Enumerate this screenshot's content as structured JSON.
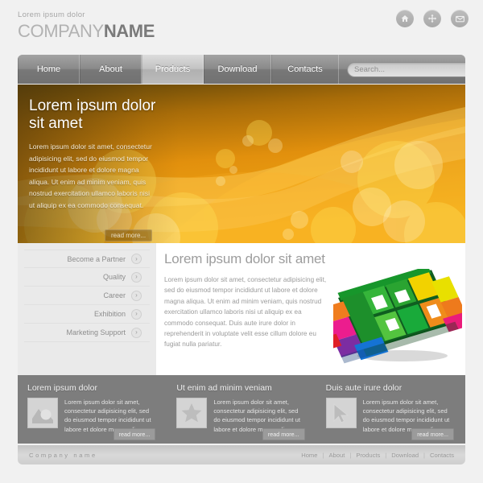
{
  "header": {
    "tagline": "Lorem ipsum dolor",
    "brand_light": "COMPANY",
    "brand_bold": "NAME",
    "icons": [
      {
        "name": "home-icon",
        "title": "Home"
      },
      {
        "name": "sitemap-move-icon",
        "title": "Sitemap"
      },
      {
        "name": "mail-icon",
        "title": "Contact"
      }
    ]
  },
  "nav": {
    "items": [
      {
        "label": "Home",
        "active": false
      },
      {
        "label": "About",
        "active": false
      },
      {
        "label": "Products",
        "active": true
      },
      {
        "label": "Download",
        "active": false
      },
      {
        "label": "Contacts",
        "active": false
      }
    ],
    "search": {
      "placeholder": "Search...",
      "value": "",
      "button_icon": "search-icon"
    }
  },
  "hero": {
    "title": "Lorem ipsum dolor sit amet",
    "body": "Lorem ipsum dolor sit amet, consectetur adipisicing elit, sed do eiusmod tempor incididunt ut labore et dolore magna aliqua. Ut enim ad minim veniam, quis nostrud exercitation ullamco laboris nisi ut aliquip ex ea commodo consequat.",
    "read_more": "read more...",
    "accent_color": "#e8940c",
    "background_colors": [
      "#6e4c0d",
      "#c87a0a",
      "#f2a81a",
      "#ffd84a"
    ]
  },
  "sidebar": {
    "items": [
      {
        "label": "Become a Partner",
        "icon": "chevron-right-icon"
      },
      {
        "label": "Quality",
        "icon": "chevron-right-icon"
      },
      {
        "label": "Career",
        "icon": "chevron-right-icon"
      },
      {
        "label": "Exhibition",
        "icon": "chevron-right-icon"
      },
      {
        "label": "Marketing Support",
        "icon": "chevron-right-icon"
      }
    ]
  },
  "content": {
    "title": "Lorem ipsum dolor sit amet",
    "body": "Lorem ipsum dolor sit amet, consectetur adipisicing elit, sed do eiusmod tempor incididunt ut labore et dolore magna aliqua. Ut enim ad minim veniam, quis nostrud exercitation ullamco laboris nisi ut aliquip ex ea commodo consequat. Duis aute irure dolor in reprehenderit in voluptate velit esse cillum dolore eu fugiat nulla pariatur.",
    "illustration": "3d-puzzle-graphic",
    "illustration_colors": [
      "#1b7c2a",
      "#3fbb32",
      "#8dc63f",
      "#f5d000",
      "#f08a1d",
      "#e8312a",
      "#ec0f8c",
      "#7b2fa0",
      "#1a6fd0",
      "#13a0e0"
    ]
  },
  "columns": [
    {
      "title": "Lorem ipsum dolor",
      "text": "Lorem ipsum dolor sit amet, consectetur adipisicing elit, sed do eiusmod tempor incididunt ut labore et dolore magna aliqua.",
      "thumb_icon": "photo-placeholder-icon",
      "read_more": "read more..."
    },
    {
      "title": "Ut enim ad minim veniam",
      "text": "Lorem ipsum dolor sit amet, consectetur adipisicing elit, sed do eiusmod tempor incididunt ut labore et dolore magna aliqua.",
      "thumb_icon": "star-icon",
      "read_more": "read more..."
    },
    {
      "title": "Duis aute irure dolor",
      "text": "Lorem ipsum dolor sit amet, consectetur adipisicing elit, sed do eiusmod tempor incididunt ut labore et dolore magna aliqua.",
      "thumb_icon": "cursor-arrow-icon",
      "read_more": "read more..."
    }
  ],
  "footer": {
    "company": "Company name",
    "links": [
      "Home",
      "About",
      "Products",
      "Download",
      "Contacts"
    ],
    "separator": "|"
  }
}
